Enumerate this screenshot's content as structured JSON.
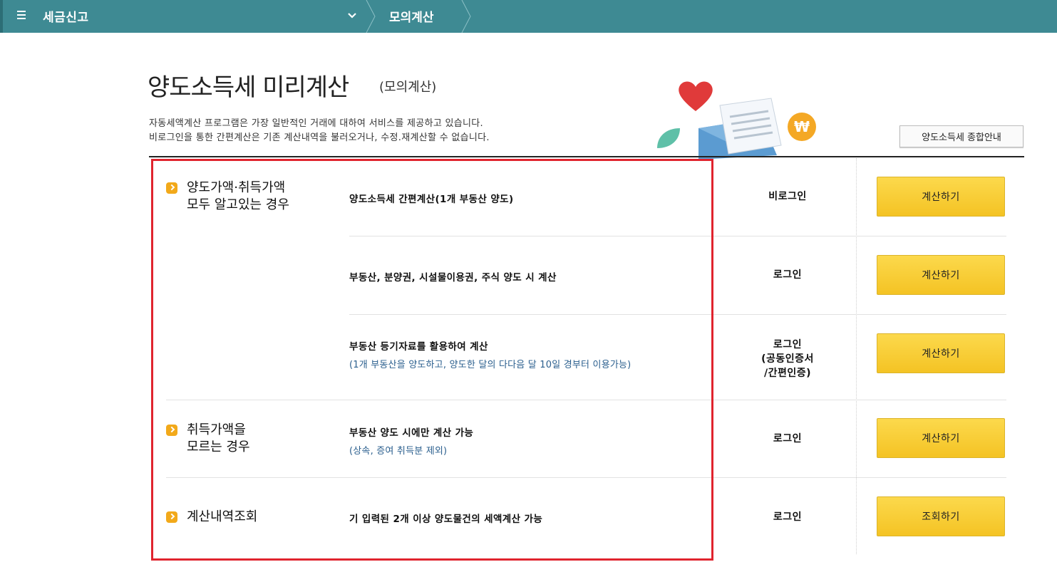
{
  "nav": {
    "title": "세금신고",
    "sub_title": "모의계산"
  },
  "header": {
    "title": "양도소득세 미리계산",
    "subtitle": "(모의계산)",
    "desc_line1": "자동세액계산 프로그램은 가장 일반적인 거래에 대하여 서비스를 제공하고 있습니다.",
    "desc_line2": "비로그인을 통한 간편계산은 기존 계산내역을 불러오거나, 수정.재계산할 수 없습니다.",
    "guide_button": "양도소득세 종합안내"
  },
  "categories": [
    {
      "line1": "양도가액·취득가액",
      "line2": "모두 알고있는 경우"
    },
    {
      "line1": "취득가액을",
      "line2": "모르는 경우"
    },
    {
      "line1": "계산내역조회"
    }
  ],
  "rows": [
    {
      "title": "양도소득세 간편계산(1개 부동산 양도)",
      "login": "비로그인",
      "button": "계산하기"
    },
    {
      "title": "부동산, 분양권, 시설물이용권, 주식 양도 시 계산",
      "login": "로그인",
      "button": "계산하기"
    },
    {
      "title": "부동산 등기자료를 활용하여 계산",
      "note": "(1개 부동산을 양도하고, 양도한 달의 다다음 달 10일 경부터 이용가능)",
      "login_line1": "로그인",
      "login_line2": "(공동인증서",
      "login_line3": "/간편인증)",
      "button": "계산하기"
    },
    {
      "title": "부동산 양도 시에만 계산 가능",
      "note": "(상속, 증여 취득분 제외)",
      "login": "로그인",
      "button": "계산하기"
    },
    {
      "title": "기 입력된 2개 이상 양도물건의 세액계산 가능",
      "login": "로그인",
      "button": "조회하기"
    }
  ],
  "colors": {
    "nav_bg": "#3e8a93",
    "button_yellow": "#f4c324",
    "bullet_orange": "#f2a91a",
    "highlight_red": "#e0242e",
    "note_blue": "#2b5f8e"
  },
  "icons": {
    "menu": "menu-icon",
    "nav_dropdown": "chevron-down-icon",
    "category_bullet": "chevron-right-bullet-icon",
    "illustration": "heart-letter-coin-illustration"
  }
}
